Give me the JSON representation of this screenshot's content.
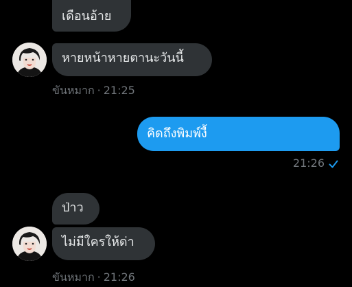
{
  "messages": [
    {
      "id": "m1",
      "direction": "received",
      "text": "เดือนอ้าย"
    },
    {
      "id": "m2",
      "direction": "received",
      "text": "หายหน้าหายตานะวันนี้"
    },
    {
      "id": "m3",
      "direction": "sent",
      "text": "คิดถึงพิมพ์งื้"
    },
    {
      "id": "m4",
      "direction": "received",
      "text": "ป่าว"
    },
    {
      "id": "m5",
      "direction": "received",
      "text": "ไม่มีใครให้ด่า"
    }
  ],
  "groups": [
    {
      "sender": "ขันหมาก",
      "separator": "·",
      "time": "21:25"
    },
    {
      "time": "21:26",
      "status_icon": "check-icon"
    },
    {
      "sender": "ขันหมาก",
      "separator": "·",
      "time": "21:26"
    }
  ],
  "avatar_icon": "user-avatar",
  "colors": {
    "background": "#000000",
    "received_bubble": "#2f3336",
    "sent_bubble": "#1d9bf0",
    "meta_text": "#71767b",
    "check": "#1d9bf0"
  }
}
